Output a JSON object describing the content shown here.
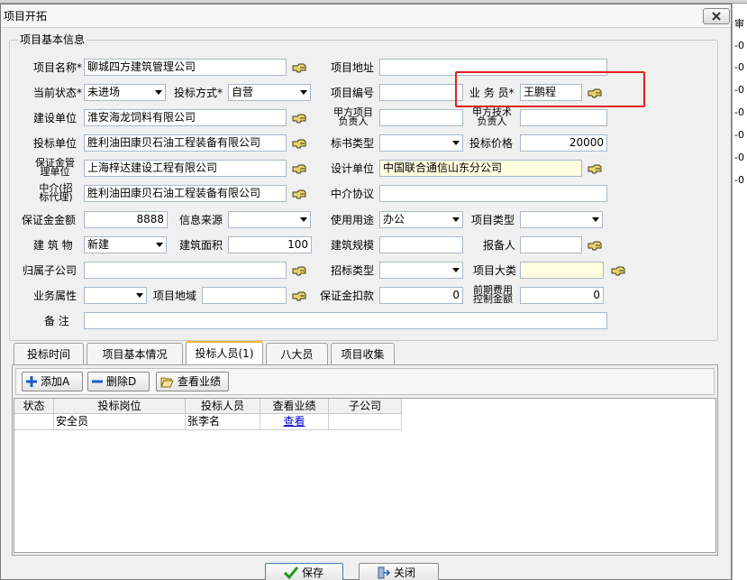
{
  "window": {
    "title": "项目开拓"
  },
  "behind": {
    "row_labels": [
      "审",
      "-0",
      "-0",
      "-0",
      "-0",
      "-0",
      "-0",
      "-0"
    ]
  },
  "group": {
    "title": "项目基本信息"
  },
  "form": {
    "project_name_label": "项目名称*",
    "project_name": "聊城四方建筑管理公司",
    "project_address_label": "项目地址",
    "project_address": "",
    "status_label": "当前状态*",
    "status": "未进场",
    "bid_method_label": "投标方式*",
    "bid_method": "自营",
    "project_no_label": "项目编号",
    "project_no": "",
    "salesman_label": "业 务 员*",
    "salesman": "王鹏程",
    "builder_label": "建设单位",
    "builder": "淮安海龙饲料有限公司",
    "party_a_lead_label_1": "甲方项目",
    "party_a_lead_label_2": "负责人",
    "party_a_lead": "",
    "party_a_tech_label_1": "甲方技术",
    "party_a_tech_label_2": "负责人",
    "party_a_tech": "",
    "bid_unit_label": "投标单位",
    "bid_unit": "胜利油田康贝石油工程装备有限公司",
    "tender_type_label": "标书类型",
    "tender_type": "",
    "bid_price_label": "投标价格",
    "bid_price": "20000",
    "guarantee_mgmt_label_1": "保证金管",
    "guarantee_mgmt_label_2": "理单位",
    "guarantee_mgmt": "上海梓达建设工程有限公司",
    "design_unit_label": "设计单位",
    "design_unit": "中国联合通信山东分公司",
    "agent_label_1": "中介(招",
    "agent_label_2": "标代理)",
    "agent": "胜利油田康贝石油工程装备有限公司",
    "agent_agreement_label": "中介协议",
    "agent_agreement": "",
    "guarantee_amount_label": "保证金金额",
    "guarantee_amount": "8888",
    "info_source_label": "信息来源",
    "info_source": "",
    "usage_label": "使用用途",
    "usage": "办公",
    "project_type_label": "项目类型",
    "project_type": "",
    "building_label": "建 筑 物",
    "building": "新建",
    "building_area_label": "建筑面积",
    "building_area": "100",
    "building_scale_label": "建筑规模",
    "building_scale": "",
    "reporter_label": "报备人",
    "reporter": "",
    "subsidiary_label": "归属子公司",
    "subsidiary": "",
    "bid_type_label": "招标类型",
    "bid_type": "",
    "project_category_label": "项目大类",
    "project_category": "",
    "biz_attr_label": "业务属性",
    "biz_attr": "",
    "project_region_label": "项目地域",
    "project_region": "",
    "guarantee_deduct_label": "保证金扣款",
    "guarantee_deduct": "0",
    "prelim_cost_label_1": "前期费用",
    "prelim_cost_label_2": "控制金额",
    "prelim_cost": "0",
    "remark_label": "备 注",
    "remark": ""
  },
  "tabs": [
    "投标时间",
    "项目基本情况",
    "投标人员(1)",
    "八大员",
    "项目收集"
  ],
  "toolbar": {
    "add": "添加A",
    "delete": "删除D",
    "view_perf": "查看业绩"
  },
  "grid": {
    "headers": [
      "状态",
      "投标岗位",
      "投标人员",
      "查看业绩",
      "子公司"
    ],
    "rows": [
      {
        "status": "",
        "position": "安全员",
        "person": "张李名",
        "perf": "查看",
        "subsidiary": ""
      }
    ]
  },
  "footer": {
    "save": "保存",
    "close": "关闭"
  },
  "colors": {
    "highlight_box": "#e02020",
    "link": "#0000cc",
    "tab_active_top": "#f7b733"
  }
}
